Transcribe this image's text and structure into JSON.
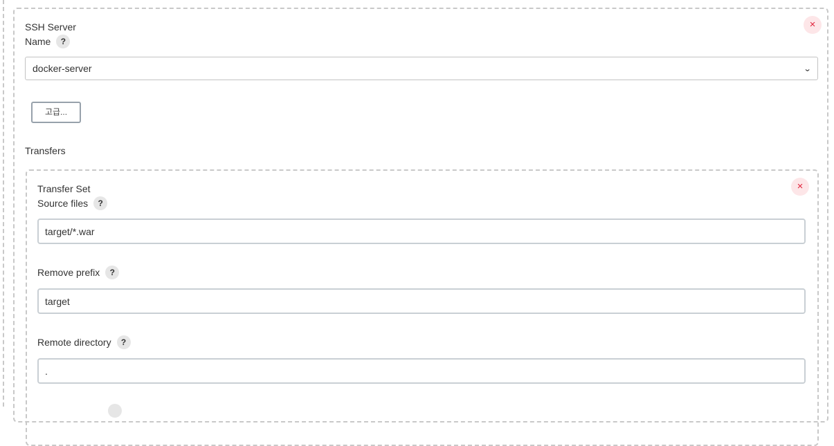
{
  "ssh_server": {
    "title": "SSH Server",
    "remove_icon": "×",
    "name_label": "Name",
    "name_help": "?",
    "name_value": "docker-server",
    "select_arrow": "⌄",
    "advanced_label": "고급...",
    "transfers_label": "Transfers"
  },
  "transfer_set": {
    "title": "Transfer Set",
    "remove_icon": "×",
    "source_files": {
      "label": "Source files",
      "help": "?",
      "value": "target/*.war"
    },
    "remove_prefix": {
      "label": "Remove prefix",
      "help": "?",
      "value": "target"
    },
    "remote_directory": {
      "label": "Remote directory",
      "help": "?",
      "value": "."
    }
  },
  "colors": {
    "remove_bg": "#fde6e8",
    "remove_fg": "#e0243c",
    "dashed_border": "#c8c8c8",
    "help_bg": "#e6e6e6"
  }
}
